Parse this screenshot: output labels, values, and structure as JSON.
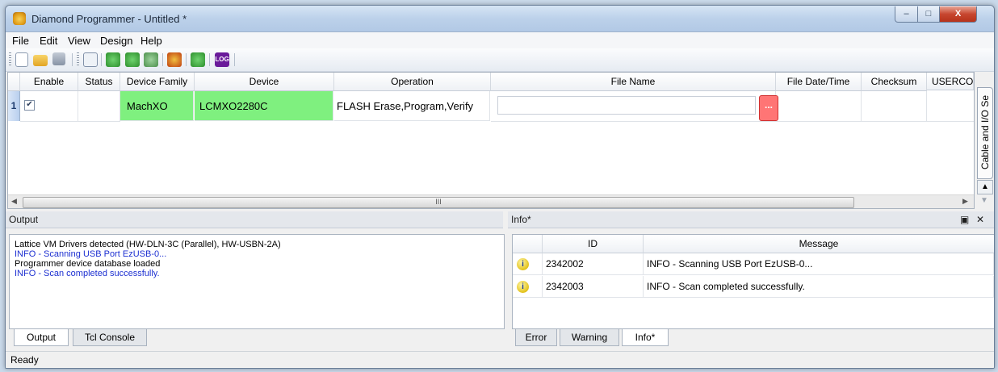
{
  "window": {
    "title": "Diamond Programmer - Untitled *"
  },
  "window_controls": {
    "minimize": "–",
    "maximize": "□",
    "close": "X"
  },
  "menu": [
    "File",
    "Edit",
    "View",
    "Design",
    "Help"
  ],
  "toolbar": {
    "log_label": "LOG",
    "icons": [
      "new-file-icon",
      "open-folder-icon",
      "save-icon",
      "scan-cable-icon",
      "program-icon",
      "program-all-icon",
      "program-edit-icon",
      "warning-program-icon",
      "download-icon",
      "log-icon"
    ]
  },
  "grid": {
    "headers": [
      "Enable",
      "Status",
      "Device Family",
      "Device",
      "Operation",
      "File Name",
      "File Date/Time",
      "Checksum",
      "USERCO"
    ],
    "row": {
      "number": "1",
      "enabled": "✔",
      "status": "",
      "device_family": "MachXO",
      "device": "LCMXO2280C",
      "operation": "FLASH Erase,Program,Verify",
      "file_name": "",
      "browse_label": "...",
      "file_date": "",
      "checksum": "",
      "userco": ""
    },
    "scroll_thumb_label": "III"
  },
  "side_panel": {
    "label": "Cable and I/O Se"
  },
  "output": {
    "title": "Output",
    "lines": [
      {
        "text": "Lattice VM Drivers detected (HW-DLN-3C (Parallel), HW-USBN-2A)",
        "color": "#000000"
      },
      {
        "text": "INFO - Scanning USB Port EzUSB-0...",
        "color": "#1c2fd1"
      },
      {
        "text": "Programmer device database loaded",
        "color": "#000000"
      },
      {
        "text": "INFO - Scan completed successfully.",
        "color": "#1c2fd1"
      }
    ],
    "tabs": [
      "Output",
      "Tcl Console"
    ]
  },
  "info": {
    "title": "Info*",
    "float_label": "▣",
    "close_label": "✕",
    "headers": [
      "ID",
      "Message"
    ],
    "rows": [
      {
        "id": "2342002",
        "message": "INFO - Scanning USB Port EzUSB-0..."
      },
      {
        "id": "2342003",
        "message": "INFO - Scan completed successfully."
      }
    ],
    "tabs": [
      "Error",
      "Warning",
      "Info*"
    ]
  },
  "status": {
    "text": "Ready"
  }
}
